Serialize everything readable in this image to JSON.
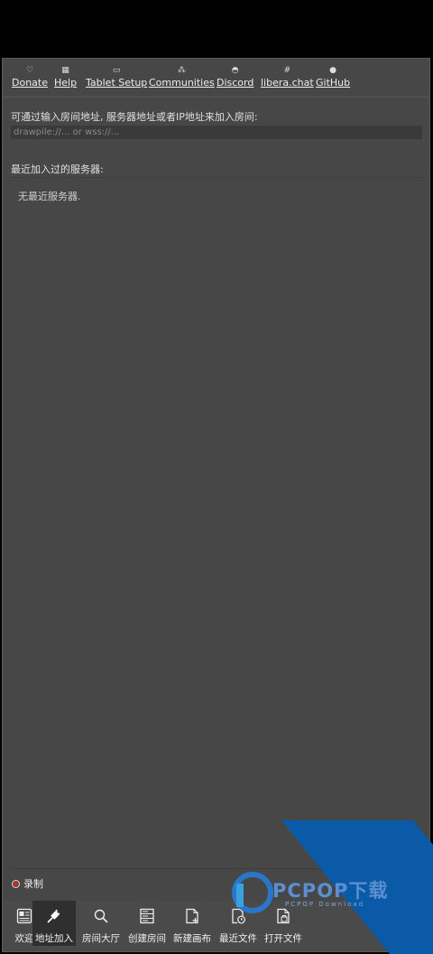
{
  "links": [
    {
      "label": "Donate",
      "icon": "heart-icon",
      "glyph": "♡"
    },
    {
      "label": "Help",
      "icon": "help-grid-icon",
      "glyph": "▦"
    },
    {
      "label": "Tablet Setup",
      "icon": "tablet-icon",
      "glyph": "▭"
    },
    {
      "label": "Communities",
      "icon": "people-icon",
      "glyph": "⁂"
    },
    {
      "label": "Discord",
      "icon": "discord-icon",
      "glyph": "◓"
    },
    {
      "label": "libera.chat",
      "icon": "hash-icon",
      "glyph": "#"
    },
    {
      "label": "GitHub",
      "icon": "github-icon",
      "glyph": "●"
    }
  ],
  "join": {
    "prompt": "可通过输入房间地址, 服务器地址或者IP地址来加入房间:",
    "placeholder": "drawpile://... or wss://..."
  },
  "recent": {
    "title": "最近加入过的服务器:",
    "empty": "无最近服务器."
  },
  "record": {
    "label": "录制",
    "icon": "record-icon"
  },
  "tabs": [
    {
      "label": "欢迎",
      "icon": "welcome-icon",
      "active": false
    },
    {
      "label": "地址加入",
      "icon": "plug-icon",
      "active": true
    },
    {
      "label": "房间大厅",
      "icon": "search-icon",
      "active": false
    },
    {
      "label": "创建房间",
      "icon": "server-icon",
      "active": false
    },
    {
      "label": "新建画布",
      "icon": "new-document-icon",
      "active": false
    },
    {
      "label": "最近文件",
      "icon": "recent-file-icon",
      "active": false
    },
    {
      "label": "打开文件",
      "icon": "open-file-icon",
      "active": false
    }
  ],
  "watermark": {
    "text": "PCPOP下载",
    "subtext": "PCPOP Download"
  },
  "colors": {
    "background": "#474747",
    "tab_active": "#2f2f2f",
    "record_dot": "#d22",
    "watermark": "#0a5aa8"
  }
}
